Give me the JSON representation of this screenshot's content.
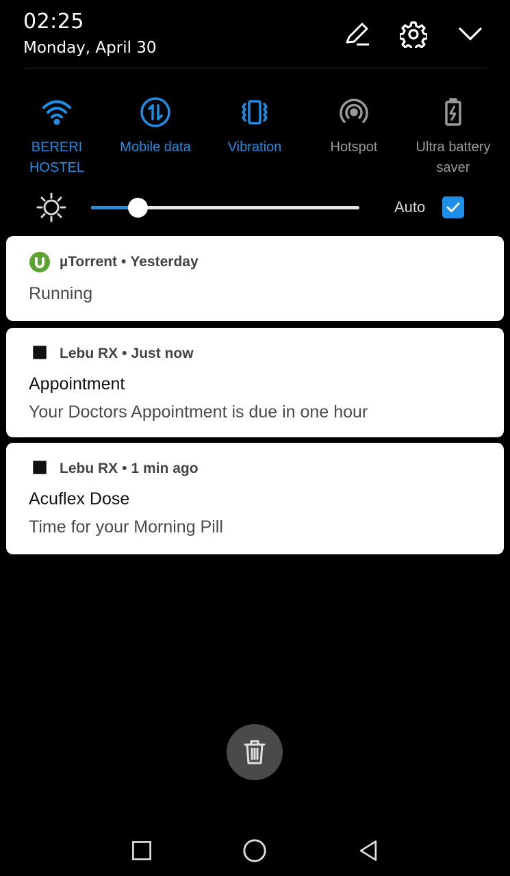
{
  "status": {
    "time": "02:25",
    "date": "Monday, April 30"
  },
  "header_icons": [
    "edit-icon",
    "settings-icon",
    "chevron-down-icon"
  ],
  "toggles": [
    {
      "icon": "wifi-icon",
      "label_line1": "BERERI",
      "label_line2": "HOSTEL",
      "state": "on"
    },
    {
      "icon": "mobile-data-icon",
      "label_line1": "Mobile data",
      "label_line2": "",
      "state": "on"
    },
    {
      "icon": "vibration-icon",
      "label_line1": "Vibration",
      "label_line2": "",
      "state": "on"
    },
    {
      "icon": "hotspot-icon",
      "label_line1": "Hotspot",
      "label_line2": "",
      "state": "off"
    },
    {
      "icon": "battery-saver-icon",
      "label_line1": "Ultra battery",
      "label_line2": "saver",
      "state": "off"
    }
  ],
  "brightness": {
    "level": 0.14,
    "auto_label": "Auto",
    "auto_checked": true
  },
  "notifications": [
    {
      "app": "µTorrent",
      "separator": "•",
      "when": "Yesterday",
      "title": "",
      "body": "Running",
      "icon": "utorrent-icon"
    },
    {
      "app": "Lebu RX",
      "separator": "•",
      "when": "Just now",
      "title": "Appointment",
      "body": "Your Doctors Appointment is due in one hour",
      "icon": "lebu-rx-icon"
    },
    {
      "app": "Lebu RX",
      "separator": "•",
      "when": "1 min ago",
      "title": "Acuflex Dose",
      "body": "Time for your Morning Pill",
      "icon": "lebu-rx-icon"
    }
  ],
  "colors": {
    "accent": "#1e8ee6",
    "inactive": "#9a9a9a",
    "background": "#000000",
    "card": "#ffffff",
    "utorrent_green": "#5aa42f"
  },
  "nav": [
    "recents-square-icon",
    "home-circle-icon",
    "back-triangle-icon"
  ]
}
